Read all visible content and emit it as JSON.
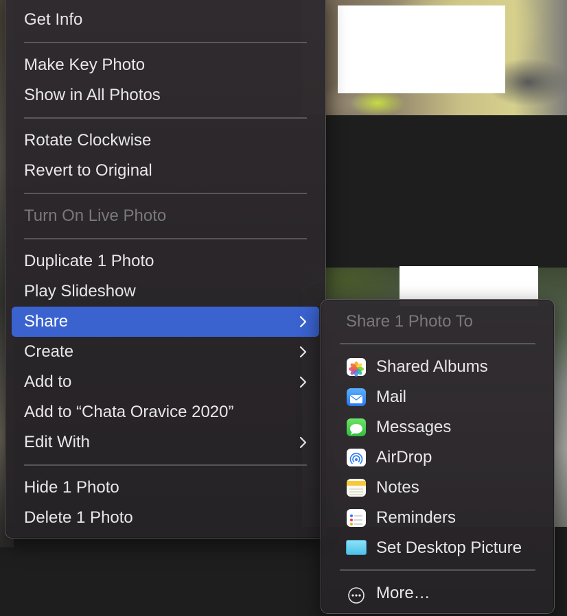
{
  "main_menu": {
    "get_info": "Get Info",
    "make_key_photo": "Make Key Photo",
    "show_in_all_photos": "Show in All Photos",
    "rotate_clockwise": "Rotate Clockwise",
    "revert_to_original": "Revert to Original",
    "turn_on_live_photo": "Turn On Live Photo",
    "duplicate": "Duplicate 1 Photo",
    "play_slideshow": "Play Slideshow",
    "share": "Share",
    "create": "Create",
    "add_to": "Add to",
    "add_to_album": "Add to “Chata Oravice 2020”",
    "edit_with": "Edit With",
    "hide": "Hide 1 Photo",
    "delete": "Delete 1 Photo"
  },
  "share_menu": {
    "header": "Share 1 Photo To",
    "items": [
      {
        "label": "Shared Albums",
        "icon": "photos-icon"
      },
      {
        "label": "Mail",
        "icon": "mail-icon"
      },
      {
        "label": "Messages",
        "icon": "messages-icon"
      },
      {
        "label": "AirDrop",
        "icon": "airdrop-icon"
      },
      {
        "label": "Notes",
        "icon": "notes-icon"
      },
      {
        "label": "Reminders",
        "icon": "reminders-icon"
      },
      {
        "label": "Set Desktop Picture",
        "icon": "desktop-picture-icon"
      }
    ],
    "more": "More…"
  },
  "colors": {
    "highlight": "#3a63d0",
    "menu_text": "#e8e6e8",
    "disabled_text": "#7b787b"
  }
}
